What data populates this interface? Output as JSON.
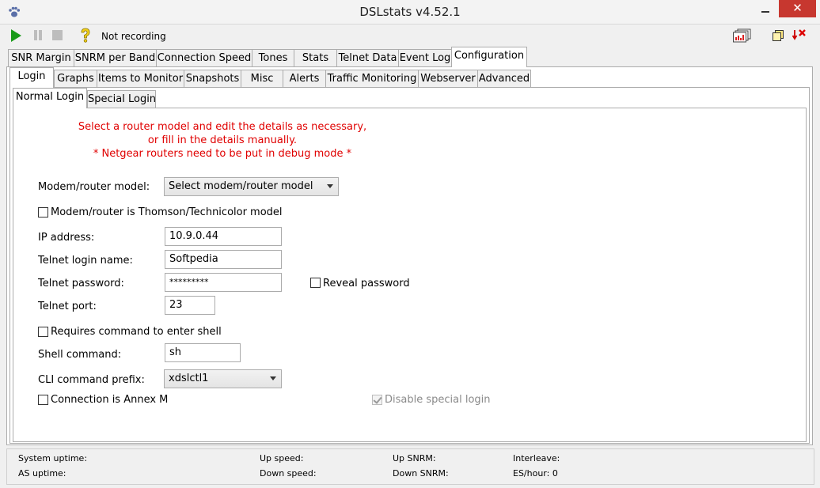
{
  "window": {
    "title": "DSLstats v4.52.1",
    "close_glyph": "✕",
    "close_color": "#c7372f"
  },
  "toolbar": {
    "status": "Not recording",
    "icons": [
      "play-icon",
      "pause-icon",
      "stop-icon",
      "help-icon",
      "graphs-icon",
      "copy-icon",
      "exit-icon"
    ]
  },
  "main_tabs": [
    "SNR Margin",
    "SNRM per Band",
    "Connection Speed",
    "Tones",
    "Stats",
    "Telnet Data",
    "Event Log",
    "Configuration"
  ],
  "config_tabs": [
    "Login",
    "Graphs",
    "Items to Monitor",
    "Snapshots",
    "Misc",
    "Alerts",
    "Traffic Monitoring",
    "Webserver",
    "Advanced"
  ],
  "login_tabs": [
    "Normal Login",
    "Special Login"
  ],
  "notice": {
    "line1": "Select a router model and edit the details as necessary,",
    "line2": "or fill in the details manually.",
    "line3": "* Netgear routers need to be put in debug mode *",
    "color": "#e00000"
  },
  "form": {
    "model_label": "Modem/router model:",
    "model_value": "Select modem/router model",
    "thomson_label": "Modem/router is Thomson/Technicolor model",
    "ip_label": "IP address:",
    "ip_value": "10.9.0.44",
    "login_label": "Telnet login name:",
    "login_value": "Softpedia",
    "password_label": "Telnet password:",
    "password_value": "*********",
    "reveal_label": "Reveal password",
    "port_label": "Telnet port:",
    "port_value": "23",
    "shell_req_label": "Requires command to enter shell",
    "shell_cmd_label": "Shell command:",
    "shell_cmd_value": "sh",
    "cli_label": "CLI command prefix:",
    "cli_value": "xdslctl1",
    "annex_label": "Connection is Annex M",
    "disable_special_label": "Disable special login",
    "disable_special_checked": true
  },
  "statusbar": {
    "system_uptime": "System uptime:",
    "as_uptime": "AS uptime:",
    "up_speed": "Up speed:",
    "down_speed": "Down speed:",
    "up_snrm": "Up SNRM:",
    "down_snrm": "Down SNRM:",
    "interleave": "Interleave:",
    "es_hour": "ES/hour: 0"
  }
}
